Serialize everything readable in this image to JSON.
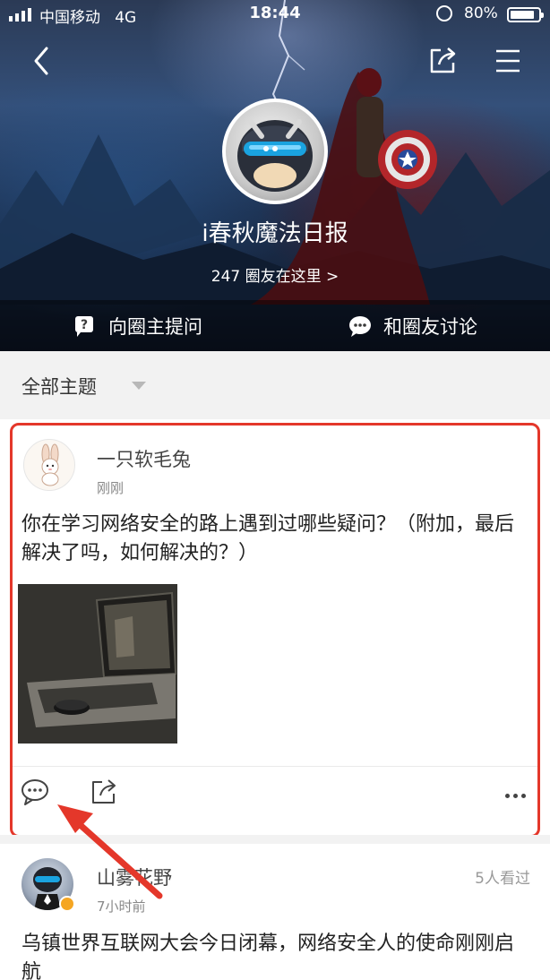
{
  "status_bar": {
    "carrier": "中国移动",
    "network": "4G",
    "time": "18:44",
    "battery": "80%",
    "battery_level": 0.8
  },
  "header": {
    "back_icon": "chevron-left-icon",
    "share_icon": "share-icon",
    "menu_icon": "hamburger-menu-icon",
    "circle_name": "i春秋魔法日报",
    "members_text": "247 圈友在这里 >",
    "ask_owner_label": "向圈主提问",
    "discuss_label": "和圈友讨论"
  },
  "filter": {
    "label": "全部主题"
  },
  "posts": [
    {
      "author": "一只软毛兔",
      "time": "刚刚",
      "text": "你在学习网络安全的路上遇到过哪些疑问？（附加，最后解决了吗，如何解决的？）"
    },
    {
      "author": "山雾花野",
      "time": "7小时前",
      "views": "5人看过",
      "text": "乌镇世界互联网大会今日闭幕，网络安全人的使命刚刚启航"
    }
  ],
  "colors": {
    "highlight_border": "#e4372a",
    "annotation_arrow": "#e4372a"
  }
}
